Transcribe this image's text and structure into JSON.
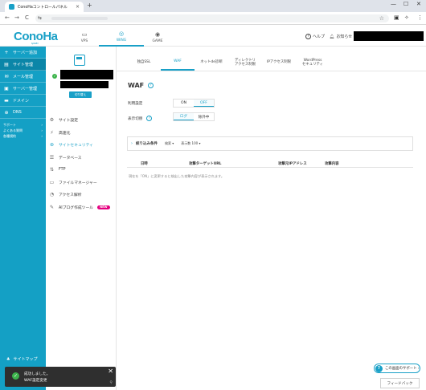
{
  "browser": {
    "tab_title": "ConoHaコントロールパネル",
    "tab_close": "×",
    "new_tab": "+",
    "minimize": "—",
    "maximize": "☐",
    "close": "✕",
    "back": "←",
    "forward": "→",
    "reload": "C",
    "site_info": "⇆",
    "star": "☆"
  },
  "header": {
    "logo": "ConoHa",
    "logo_sub": "by GMO",
    "services": [
      {
        "label": "VPS",
        "icon": "▭"
      },
      {
        "label": "WING",
        "icon": "◎"
      },
      {
        "label": "GAME",
        "icon": "◉"
      }
    ],
    "help_label": "ヘルプ",
    "notice_label": "お知らせ"
  },
  "sidebar": {
    "items": [
      {
        "label": "サーバー追加",
        "icon": "+"
      },
      {
        "label": "サイト管理",
        "icon": "▤"
      },
      {
        "label": "メール管理",
        "icon": "✉"
      },
      {
        "label": "サーバー管理",
        "icon": "▣"
      },
      {
        "label": "ドメイン",
        "icon": "▬"
      },
      {
        "label": "DNS",
        "icon": "⊕"
      }
    ],
    "sub": [
      {
        "label": "サポート",
        "arrow": "›"
      },
      {
        "label": "よくある質問",
        "arrow": "›"
      },
      {
        "label": "各種規約",
        "arrow": "›"
      }
    ],
    "sitemap": "サイトマップ",
    "sitemap_icon": "♣"
  },
  "panel2": {
    "status_check": "✓",
    "switch_label": "切り替え",
    "menu": [
      {
        "label": "サイト設定",
        "icon": "⚙"
      },
      {
        "label": "高速化",
        "icon": "⚡"
      },
      {
        "label": "サイトセキュリティ",
        "icon": "⊛",
        "active": true
      },
      {
        "label": "データベース",
        "icon": "☰"
      },
      {
        "label": "FTP",
        "icon": "⇅"
      },
      {
        "label": "ファイルマネージャー",
        "icon": "▭"
      },
      {
        "label": "アクセス解析",
        "icon": "◔"
      },
      {
        "label": "AIブログ作成ツール",
        "icon": "✎",
        "badge": "NEW"
      }
    ]
  },
  "subtabs": [
    {
      "label": "独自SSL"
    },
    {
      "label": "WAF",
      "active": true
    },
    {
      "label": "ネットde診断"
    },
    {
      "label": "ディレクトリ\nアクセス制限"
    },
    {
      "label": "IPアクセス制限"
    },
    {
      "label": "WordPress\nセキュリティ"
    }
  ],
  "waf": {
    "title": "WAF",
    "help": "?",
    "usage_label": "利用設定",
    "usage_on": "ON",
    "usage_off": "OFF",
    "mode_label": "表示切替",
    "mode_log": "ログ",
    "mode_exclude": "除外中",
    "filter_chevron": "›",
    "filter_label": "絞り込み条件",
    "filter_period": "検索 ▾",
    "filter_count": "表示数  100 ▾",
    "columns": [
      "日時",
      "攻撃ターゲットURL",
      "攻撃元IPアドレス",
      "攻撃内容"
    ],
    "empty": "現在を「ON」に変更すると検出した攻撃内容が表示されます。"
  },
  "help_bubble": {
    "icon": "?",
    "label": "この画面のサポート ›"
  },
  "feedback": "フィードバック",
  "toast": {
    "check": "✓",
    "title": "成功しました。",
    "message": "WAF設定変更",
    "close": "✕",
    "pin": "⚲"
  }
}
